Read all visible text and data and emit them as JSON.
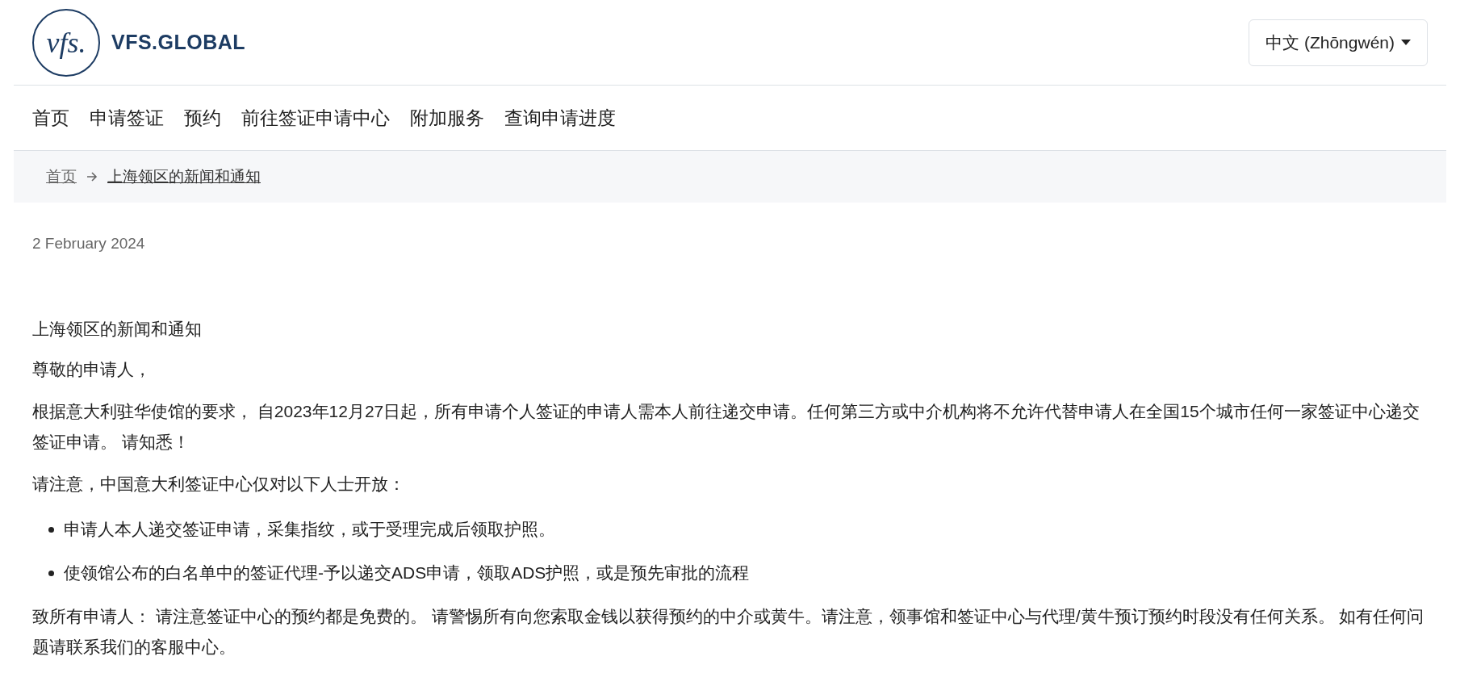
{
  "header": {
    "logo": {
      "mark": "vfs.",
      "wordmark": "VFS.GLOBAL"
    },
    "language_button": "中文 (Zhōngwén)"
  },
  "nav": [
    "首页",
    "申请签证",
    "预约",
    "前往签证申请中心",
    "附加服务",
    "查询申请进度"
  ],
  "breadcrumb": [
    "首页",
    "上海领区的新闻和通知"
  ],
  "article": {
    "date": "2 February 2024",
    "title": "上海领区的新闻和通知",
    "paragraphs": [
      "尊敬的申请人，",
      "根据意大利驻华使馆的要求， 自2023年12月27日起，所有申请个人签证的申请人需本人前往递交申请。任何第三方或中介机构将不允许代替申请人在全国15个城市任何一家签证中心递交签证申请。 请知悉！",
      "请注意，中国意大利签证中心仅对以下人士开放："
    ],
    "bullets": [
      "申请人本人递交签证申请，采集指纹，或于受理完成后领取护照。",
      "使领馆公布的白名单中的签证代理-予以递交ADS申请，领取ADS护照，或是预先审批的流程"
    ],
    "closing": "致所有申请人： 请注意签证中心的预约都是免费的。 请警惕所有向您索取金钱以获得预约的中介或黄牛。请注意，领事馆和签证中心与代理/黄牛预订预约时段没有任何关系。 如有任何问题请联系我们的客服中心。"
  }
}
